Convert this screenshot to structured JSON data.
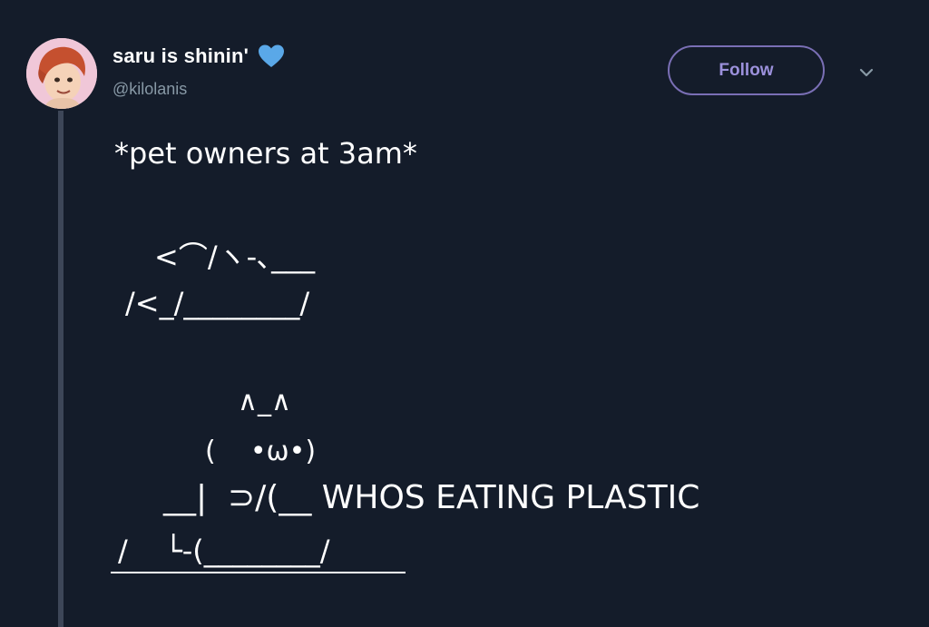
{
  "tweet": {
    "user": {
      "display_name": "saru is shinin'",
      "handle": "@kilolanis"
    },
    "follow_label": "Follow",
    "text": "*pet owners at 3am*",
    "ascii_art": {
      "line1": "<⌒/ヽ-､___",
      "line2": "/<_/________/",
      "line3": "∧_∧",
      "line4": "(    •ω•)",
      "line5": "__|  ⊃/(__ WHOS EATING PLASTIC",
      "line6": "/    └-(________/"
    }
  },
  "icons": {
    "verified_heart": "blue-heart-icon",
    "avatar": "avatar-illustration",
    "menu": "chevron-down-icon"
  },
  "colors": {
    "background": "#141c2a",
    "handle": "#8899a6",
    "follow_accent": "#9c91dc",
    "heart": "#5aa8e8",
    "thread_line": "#3d4658"
  }
}
